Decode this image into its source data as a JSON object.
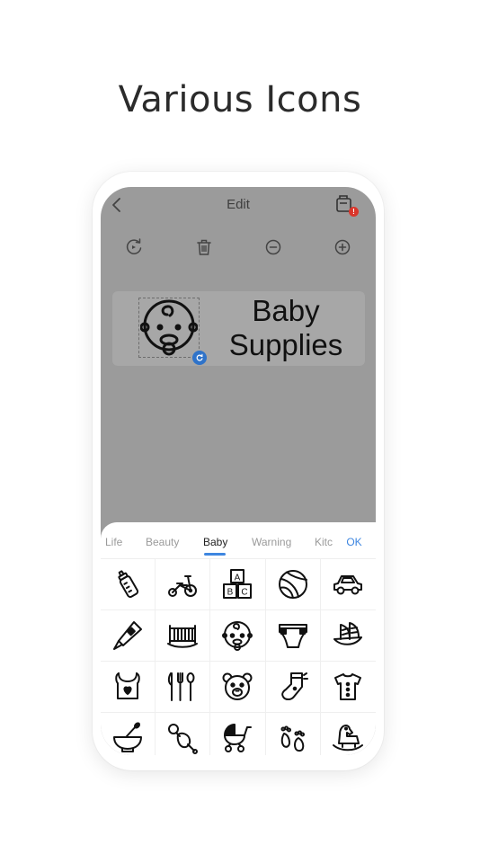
{
  "headline": "Various Icons",
  "editor": {
    "title": "Edit",
    "printer_badge": "!",
    "tools": [
      "rotate-icon",
      "trash-icon",
      "zoom-out-icon",
      "zoom-in-icon"
    ]
  },
  "label": {
    "icon": "baby-face-icon",
    "line1": "Baby",
    "line2": "Supplies"
  },
  "icon_picker": {
    "tabs": [
      "Life",
      "Beauty",
      "Baby",
      "Warning",
      "Kitchen"
    ],
    "active_tab": "Baby",
    "ok_label": "OK",
    "block_letters": [
      "A",
      "B",
      "C"
    ],
    "icons": [
      "baby-bottle-icon",
      "tricycle-icon",
      "abc-blocks-icon",
      "ball-icon",
      "toy-car-icon",
      "thermometer-icon",
      "crib-icon",
      "baby-face-icon",
      "diaper-icon",
      "toy-boat-icon",
      "bib-icon",
      "cutlery-icon",
      "teddy-bear-icon",
      "baby-sock-icon",
      "baby-shirt-icon",
      "baby-bowl-icon",
      "pacifier-icon",
      "stroller-icon",
      "footprints-icon",
      "rocking-horse-icon"
    ]
  }
}
